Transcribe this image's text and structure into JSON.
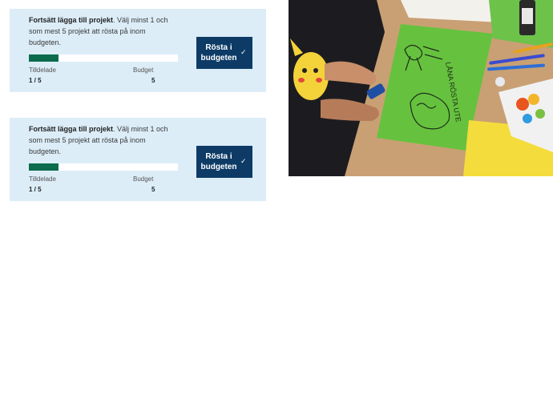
{
  "cards": [
    {
      "title": "Fortsätt lägga till projekt",
      "message": ". Välj minst 1 och som mest 5 projekt att rösta på inom budgeten.",
      "progress_fraction": 0.2,
      "allocated_label": "Tilldelade",
      "allocated_value": "1 / 5",
      "budget_label": "Budget",
      "budget_value": "5",
      "vote_button_label": "Rösta i budgeten",
      "vote_button_icon": "check-icon"
    },
    {
      "title": "Fortsätt lägga till projekt",
      "message": ". Välj minst 1 och som mest 5 projekt att rösta på inom budgeten.",
      "progress_fraction": 0.2,
      "allocated_label": "Tilldelade",
      "allocated_value": "1 / 5",
      "budget_label": "Budget",
      "budget_value": "5",
      "vote_button_label": "Rösta i budgeten",
      "vote_button_icon": "check-icon"
    }
  ],
  "colors": {
    "panel_bg": "#dcedf8",
    "progress_fill": "#0b6b4c",
    "button_bg": "#0d3b66"
  },
  "photo": {
    "description_icon": "children-drawing-photo",
    "handwriting": "LÅNA RÖSTA UTE"
  }
}
